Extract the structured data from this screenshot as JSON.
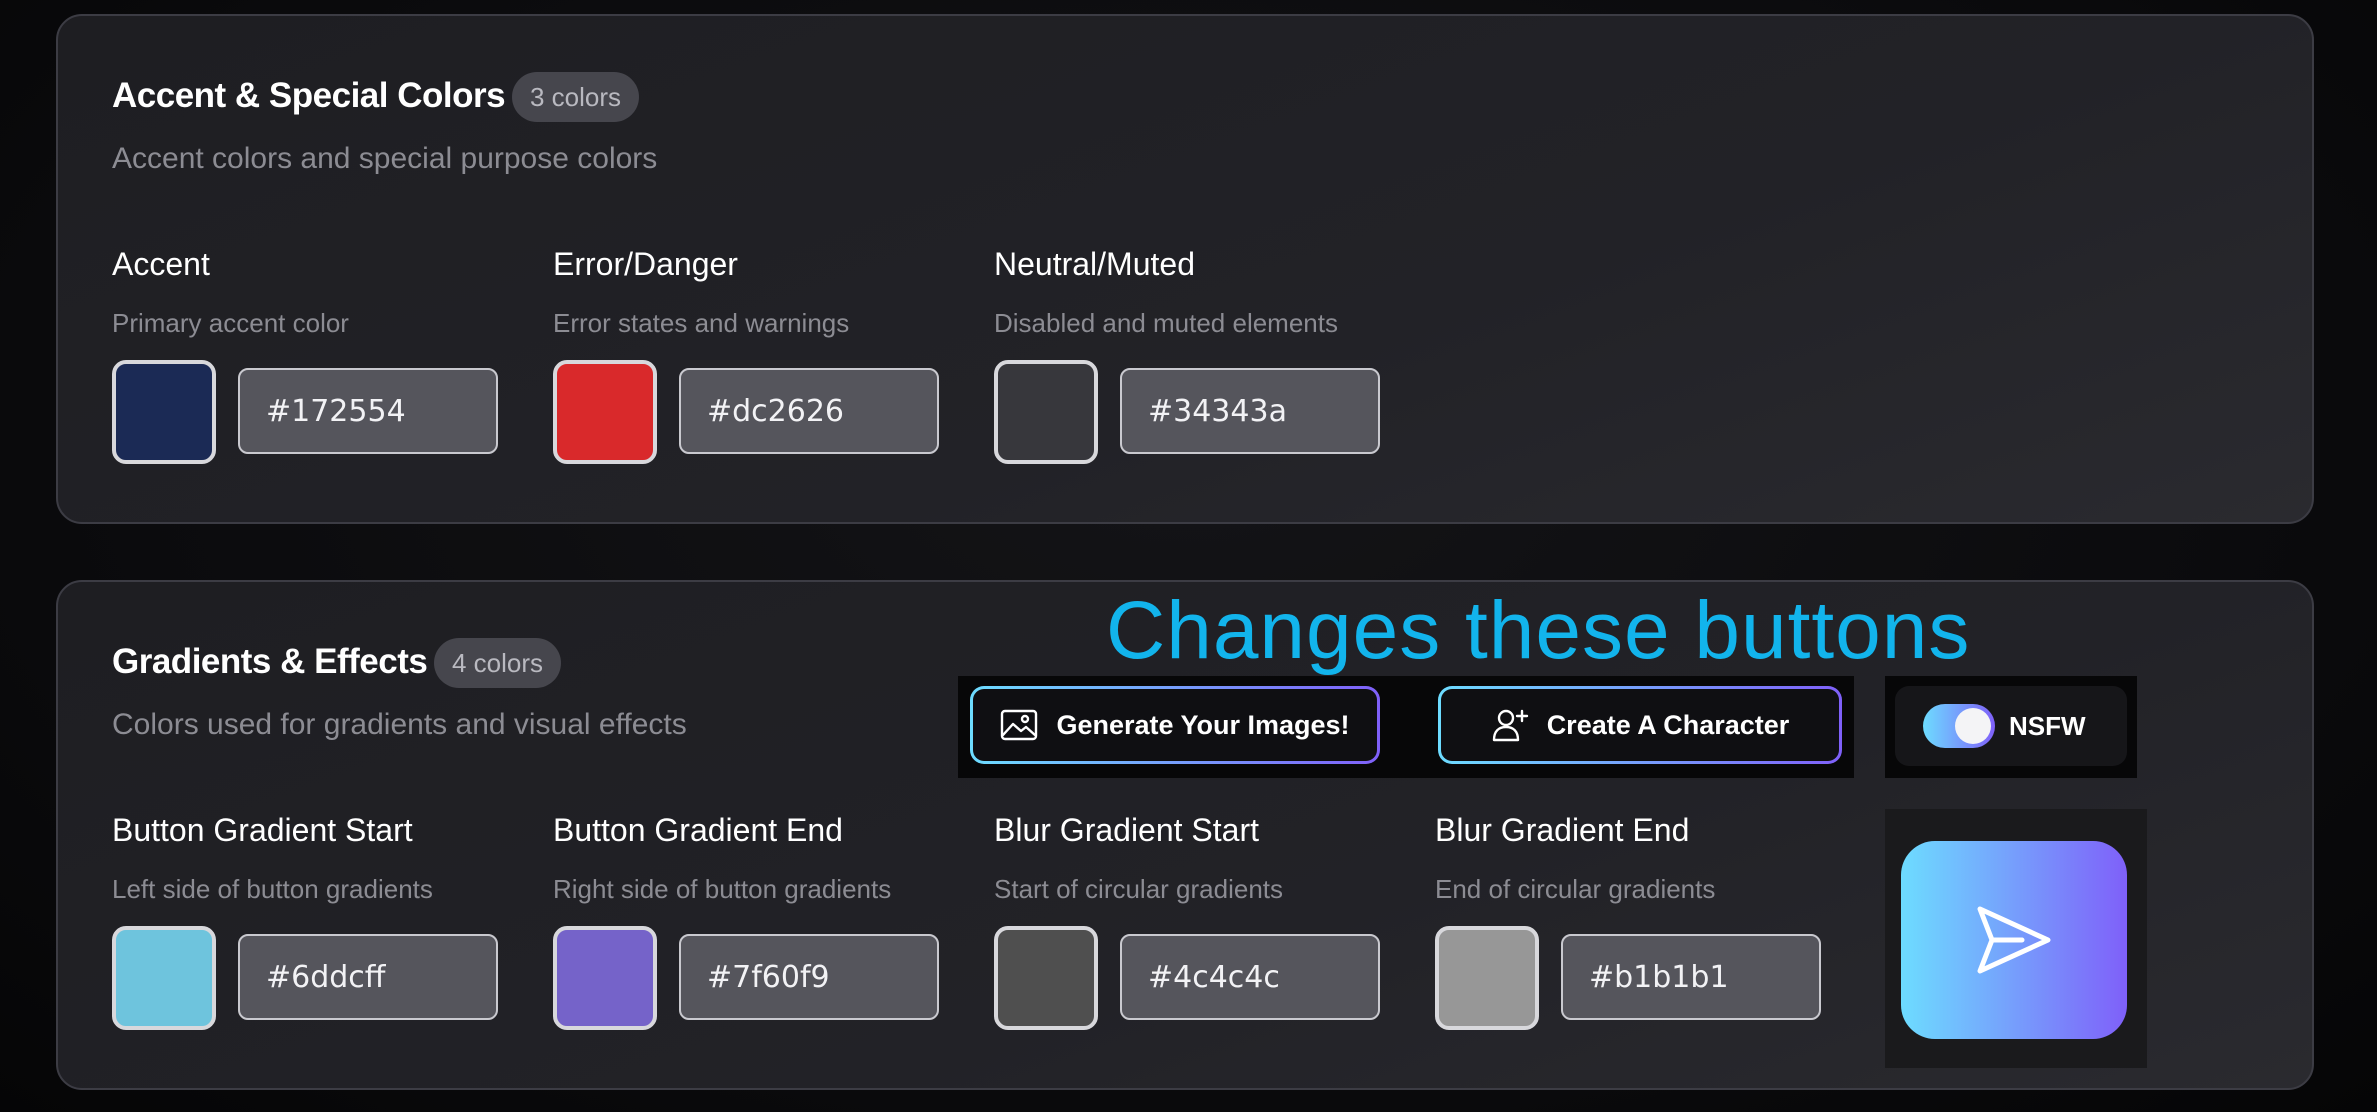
{
  "accent_section": {
    "title": "Accent & Special Colors",
    "count": "3 colors",
    "description": "Accent colors and special purpose colors",
    "items": [
      {
        "name": "Accent",
        "help": "Primary accent color",
        "hex": "#172554"
      },
      {
        "name": "Error/Danger",
        "help": "Error states and warnings",
        "hex": "#dc2626"
      },
      {
        "name": "Neutral/Muted",
        "help": "Disabled and muted elements",
        "hex": "#34343a"
      }
    ]
  },
  "gradient_section": {
    "title": "Gradients & Effects",
    "count": "4 colors",
    "description": "Colors used for gradients and visual effects",
    "items": [
      {
        "name": "Button Gradient Start",
        "help": "Left side of button gradients",
        "hex": "#6ddcff"
      },
      {
        "name": "Button Gradient End",
        "help": "Right side of button gradients",
        "hex": "#7f60f9"
      },
      {
        "name": "Blur Gradient Start",
        "help": "Start of circular gradients",
        "hex": "#4c4c4c"
      },
      {
        "name": "Blur Gradient End",
        "help": "End of circular gradients",
        "hex": "#b1b1b1"
      }
    ]
  },
  "annotation": "Changes these buttons",
  "preview": {
    "generate_label": "Generate Your Images!",
    "generate_icon": "image-icon",
    "create_label": "Create A Character",
    "create_icon": "user-plus-icon",
    "nsfw_label": "NSFW",
    "nsfw_enabled": true,
    "send_icon": "send-icon"
  },
  "colors": {
    "swatch_accent": "#1b2a55",
    "swatch_error": "#d9292b",
    "swatch_neutral": "#37373c",
    "swatch_button_start": "#6ec4dd",
    "swatch_button_end": "#7563c9",
    "swatch_blur_start": "#4f4f4f",
    "swatch_blur_end": "#979797",
    "annotation": "#12b4ec"
  }
}
